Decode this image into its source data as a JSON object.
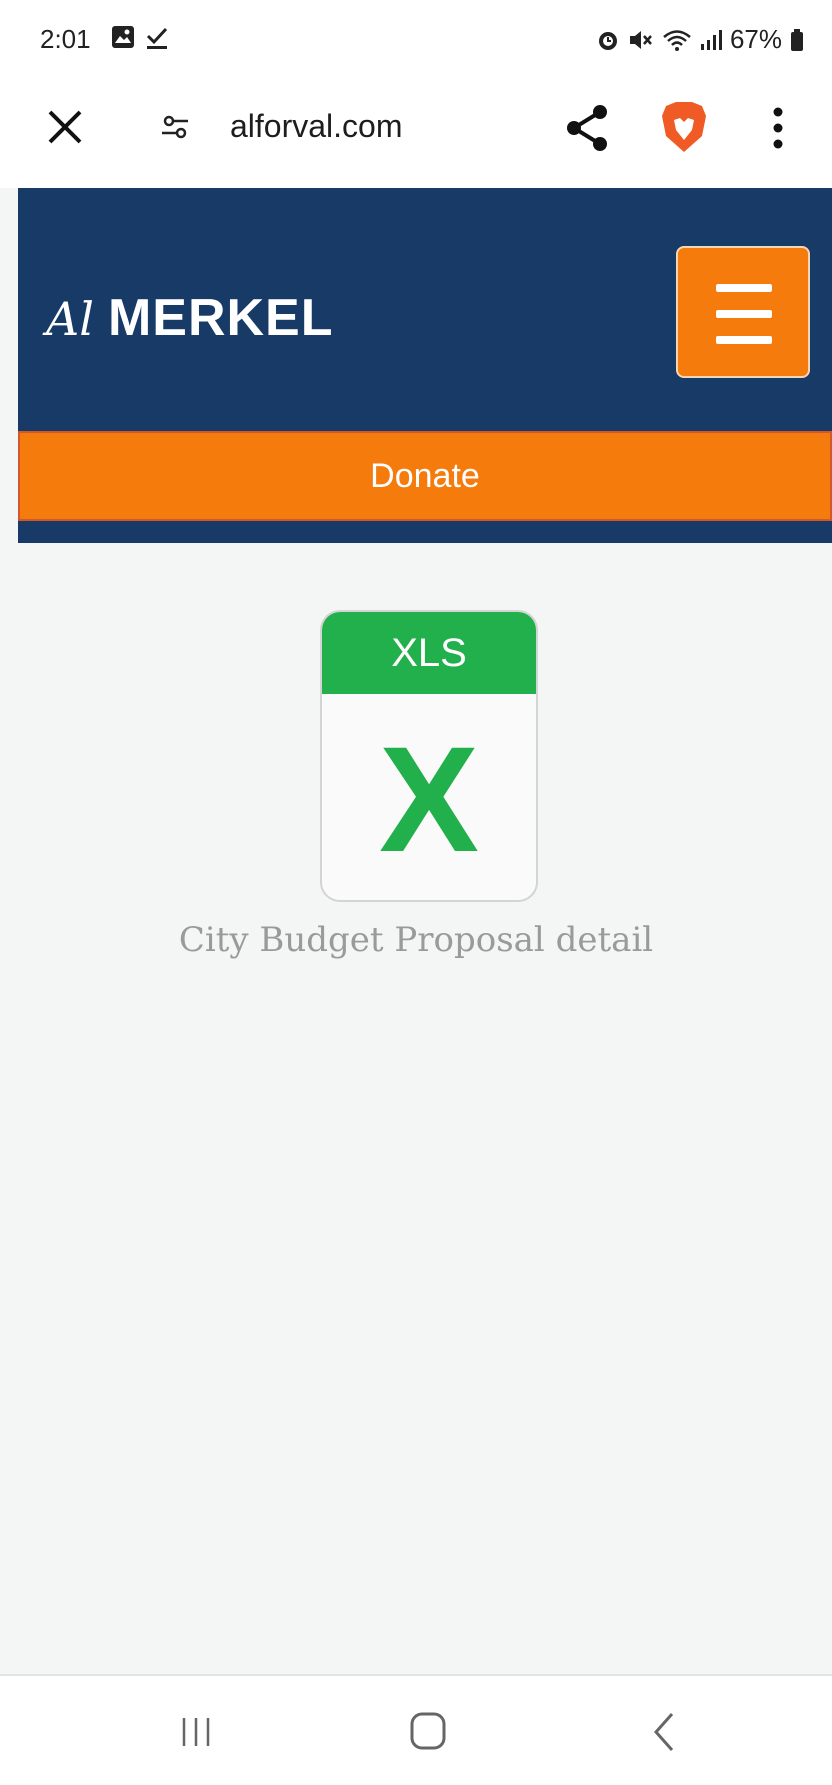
{
  "status_bar": {
    "time": "2:01",
    "battery": "67%"
  },
  "browser": {
    "url": "alforval.com",
    "icons": [
      "close-icon",
      "site-settings-icon",
      "share-icon",
      "brave-lion-icon",
      "more-vert-icon"
    ]
  },
  "site": {
    "logo_script": "Al",
    "logo_name": "MERKEL",
    "donate_label": "Donate",
    "colors": {
      "header_bg": "#173b66",
      "accent_orange": "#f47b0c",
      "xls_green": "#22b04c"
    }
  },
  "file": {
    "type_label": "XLS",
    "glyph": "X",
    "caption": "City Budget Proposal detail"
  },
  "nav_bar": {
    "icons": [
      "recent-apps-icon",
      "home-icon",
      "back-icon"
    ]
  }
}
